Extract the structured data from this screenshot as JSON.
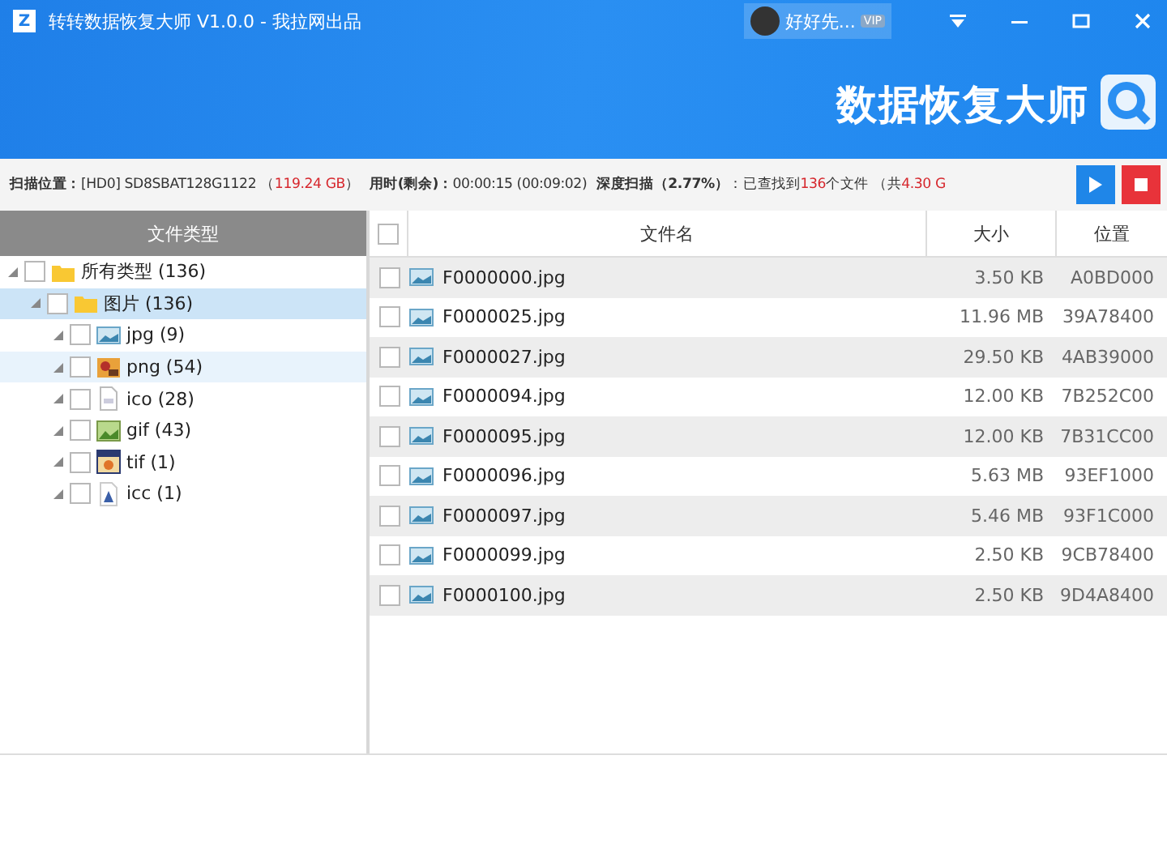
{
  "window": {
    "title": "转转数据恢复大师 V1.0.0 - 我拉网出品",
    "logo_letter": "Z"
  },
  "user": {
    "name": "好好先...",
    "badge": "VIP"
  },
  "banner": {
    "brand": "数据恢复大师"
  },
  "scan_status": [
    {
      "kind": "label",
      "text": "扫描位置："
    },
    {
      "kind": "plain",
      "text": "[HD0] SD8SBAT128G1122 （"
    },
    {
      "kind": "highlight",
      "text": "119.24 GB"
    },
    {
      "kind": "plain",
      "text": "）"
    },
    {
      "kind": "label",
      "text": "用时(剩余)："
    },
    {
      "kind": "plain",
      "text": "00:00:15 (00:09:02)"
    },
    {
      "kind": "label",
      "text": "深度扫描（2.77%）"
    },
    {
      "kind": "plain",
      "text": "：已查找到"
    },
    {
      "kind": "highlight",
      "text": "136"
    },
    {
      "kind": "plain",
      "text": "个文件 （共"
    },
    {
      "kind": "highlight",
      "text": "4.30 G"
    }
  ],
  "sidebar": {
    "title": "文件类型",
    "tree": [
      {
        "label": "所有类型 (136)",
        "kind": "folder",
        "checked": false,
        "selected": false,
        "hovered": false,
        "children": [
          {
            "label": "图片 (136)",
            "kind": "folder",
            "checked": false,
            "selected": true,
            "hovered": false,
            "children": [
              {
                "label": "jpg (9)",
                "kind": "jpg",
                "checked": false,
                "selected": false,
                "hovered": false
              },
              {
                "label": "png (54)",
                "kind": "png",
                "checked": false,
                "selected": false,
                "hovered": true
              },
              {
                "label": "ico (28)",
                "kind": "ico",
                "checked": false,
                "selected": false,
                "hovered": false
              },
              {
                "label": "gif (43)",
                "kind": "gif",
                "checked": false,
                "selected": false,
                "hovered": false
              },
              {
                "label": "tif (1)",
                "kind": "tif",
                "checked": false,
                "selected": false,
                "hovered": false
              },
              {
                "label": "icc (1)",
                "kind": "icc",
                "checked": false,
                "selected": false,
                "hovered": false
              }
            ]
          }
        ]
      }
    ]
  },
  "table": {
    "columns": [
      "文件名",
      "大小",
      "位置"
    ],
    "header_checked": false,
    "rows": [
      {
        "name": "F0000000.jpg",
        "size": "3.50 KB",
        "location": "A0BD000",
        "checked": false
      },
      {
        "name": "F0000025.jpg",
        "size": "11.96 MB",
        "location": "39A78400",
        "checked": false
      },
      {
        "name": "F0000027.jpg",
        "size": "29.50 KB",
        "location": "4AB39000",
        "checked": false
      },
      {
        "name": "F0000094.jpg",
        "size": "12.00 KB",
        "location": "7B252C00",
        "checked": false
      },
      {
        "name": "F0000095.jpg",
        "size": "12.00 KB",
        "location": "7B31CC00",
        "checked": false
      },
      {
        "name": "F0000096.jpg",
        "size": "5.63 MB",
        "location": "93EF1000",
        "checked": false
      },
      {
        "name": "F0000097.jpg",
        "size": "5.46 MB",
        "location": "93F1C000",
        "checked": false
      },
      {
        "name": "F0000099.jpg",
        "size": "2.50 KB",
        "location": "9CB78400",
        "checked": false
      },
      {
        "name": "F0000100.jpg",
        "size": "2.50 KB",
        "location": "9D4A8400",
        "checked": false
      }
    ]
  }
}
